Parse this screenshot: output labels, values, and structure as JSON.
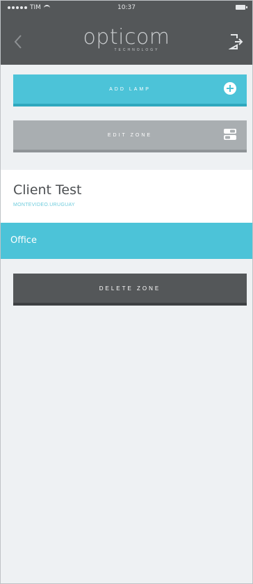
{
  "status_bar": {
    "carrier": "TIM",
    "time": "10:37"
  },
  "header": {
    "logo_text": "opticom",
    "logo_subtext": "TECHNOLOGY"
  },
  "actions": {
    "add_lamp_label": "ADD LAMP",
    "edit_zone_label": "EDIT ZONE",
    "delete_zone_label": "DELETE ZONE"
  },
  "client": {
    "name": "Client Test",
    "address": "MONTEVIDEO.URUGUAY"
  },
  "zone": {
    "name": "Office"
  },
  "colors": {
    "header_bg": "#545759",
    "accent": "#4cc3d8",
    "edit_bg": "#a9aeb1",
    "delete_bg": "#545759",
    "page_bg": "#eef1f3"
  },
  "icons": {
    "back": "chevron-left-icon",
    "exit": "logout-icon",
    "add": "plus-circle-icon",
    "edit": "toggle-icon"
  }
}
